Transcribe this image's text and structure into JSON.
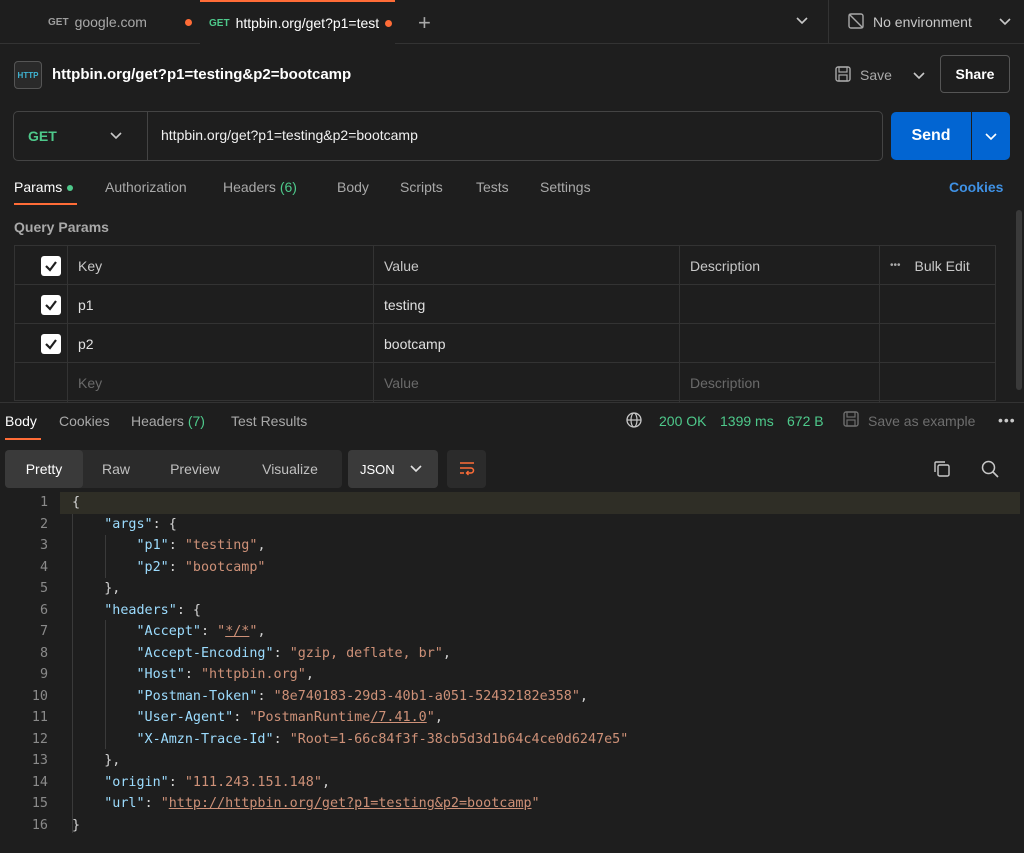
{
  "tabs": [
    {
      "method": "GET",
      "label": "google.com"
    },
    {
      "method": "GET",
      "label": "httpbin.org/get?p1=test"
    }
  ],
  "environment": "No environment",
  "request": {
    "title": "httpbin.org/get?p1=testing&p2=bootcamp",
    "icon_text": "HTTP",
    "save_label": "Save",
    "share_label": "Share",
    "method": "GET",
    "url": "httpbin.org/get?p1=testing&p2=bootcamp",
    "send_label": "Send"
  },
  "request_tabs": {
    "params": "Params",
    "authorization": "Authorization",
    "headers": "Headers",
    "headers_count": "(6)",
    "body": "Body",
    "scripts": "Scripts",
    "tests": "Tests",
    "settings": "Settings",
    "cookies": "Cookies"
  },
  "query_params": {
    "label": "Query Params",
    "columns": {
      "key": "Key",
      "value": "Value",
      "description": "Description",
      "bulk_edit": "Bulk Edit",
      "more": "•••"
    },
    "rows": [
      {
        "key": "p1",
        "value": "testing"
      },
      {
        "key": "p2",
        "value": "bootcamp"
      }
    ],
    "placeholders": {
      "key": "Key",
      "value": "Value",
      "description": "Description"
    }
  },
  "response": {
    "tabs": {
      "body": "Body",
      "cookies": "Cookies",
      "headers": "Headers",
      "headers_count": "(7)",
      "test_results": "Test Results"
    },
    "status": "200 OK",
    "time": "1399 ms",
    "size": "672 B",
    "save_example": "Save as example",
    "more": "•••",
    "view_modes": [
      "Pretty",
      "Raw",
      "Preview",
      "Visualize"
    ],
    "format": "JSON"
  },
  "code_lines": [
    {
      "n": "1",
      "t": "{"
    },
    {
      "n": "2",
      "t": "    \"args\": {"
    },
    {
      "n": "3",
      "t": "        \"p1\": \"testing\","
    },
    {
      "n": "4",
      "t": "        \"p2\": \"bootcamp\""
    },
    {
      "n": "5",
      "t": "    },"
    },
    {
      "n": "6",
      "t": "    \"headers\": {"
    },
    {
      "n": "7",
      "t": "        \"Accept\": \"*/*\","
    },
    {
      "n": "8",
      "t": "        \"Accept-Encoding\": \"gzip, deflate, br\","
    },
    {
      "n": "9",
      "t": "        \"Host\": \"httpbin.org\","
    },
    {
      "n": "10",
      "t": "        \"Postman-Token\": \"8e740183-29d3-40b1-a051-52432182e358\","
    },
    {
      "n": "11",
      "t": "        \"User-Agent\": \"PostmanRuntime/7.41.0\","
    },
    {
      "n": "12",
      "t": "        \"X-Amzn-Trace-Id\": \"Root=1-66c84f3f-38cb5d3d1b64c4ce0d6247e5\""
    },
    {
      "n": "13",
      "t": "    },"
    },
    {
      "n": "14",
      "t": "    \"origin\": \"111.243.151.148\","
    },
    {
      "n": "15",
      "t": "    \"url\": \"http://httpbin.org/get?p1=testing&p2=bootcamp\""
    },
    {
      "n": "16",
      "t": "}"
    }
  ]
}
